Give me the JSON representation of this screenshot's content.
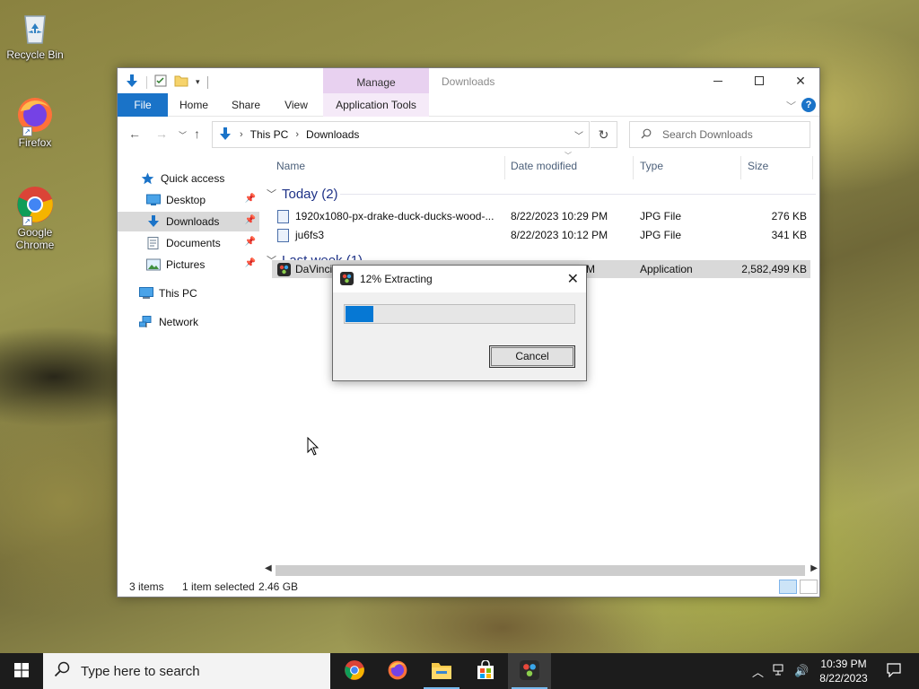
{
  "desktop": {
    "icons": [
      {
        "label": "Recycle Bin"
      },
      {
        "label": "Firefox"
      },
      {
        "label": "Google Chrome"
      }
    ]
  },
  "explorer": {
    "title": "Downloads",
    "context_tab": "Manage",
    "tabs": [
      "File",
      "Home",
      "Share",
      "View",
      "Application Tools"
    ],
    "address": {
      "crumbs": [
        "This PC",
        "Downloads"
      ]
    },
    "search_placeholder": "Search Downloads",
    "nav": {
      "quick_access": "Quick access",
      "items": [
        {
          "label": "Desktop",
          "pinned": true
        },
        {
          "label": "Downloads",
          "pinned": true,
          "selected": true
        },
        {
          "label": "Documents",
          "pinned": true
        },
        {
          "label": "Pictures",
          "pinned": true
        }
      ],
      "this_pc": "This PC",
      "network": "Network"
    },
    "columns": [
      "Name",
      "Date modified",
      "Type",
      "Size"
    ],
    "groups": [
      {
        "label": "Today (2)",
        "rows": [
          {
            "name": "1920x1080-px-drake-duck-ducks-wood-...",
            "date": "8/22/2023 10:29 PM",
            "type": "JPG File",
            "size": "276 KB"
          },
          {
            "name": "ju6fs3",
            "date": "8/22/2023 10:12 PM",
            "type": "JPG File",
            "size": "341 KB"
          }
        ]
      },
      {
        "label": "Last week (1)",
        "rows": [
          {
            "name": "DaVinci_",
            "date": "M",
            "type": "Application",
            "size": "2,582,499 KB",
            "selected": true
          }
        ]
      }
    ],
    "status": {
      "items": "3 items",
      "selected": "1 item selected",
      "size": "2.46 GB"
    }
  },
  "dialog": {
    "title": "12% Extracting",
    "progress": 0.12,
    "cancel_label": "Cancel"
  },
  "taskbar": {
    "search_placeholder": "Type here to search",
    "time": "10:39 PM",
    "date": "8/22/2023",
    "apps": [
      "chrome",
      "firefox",
      "file-explorer",
      "microsoft-store",
      "davinci-resolve"
    ]
  }
}
